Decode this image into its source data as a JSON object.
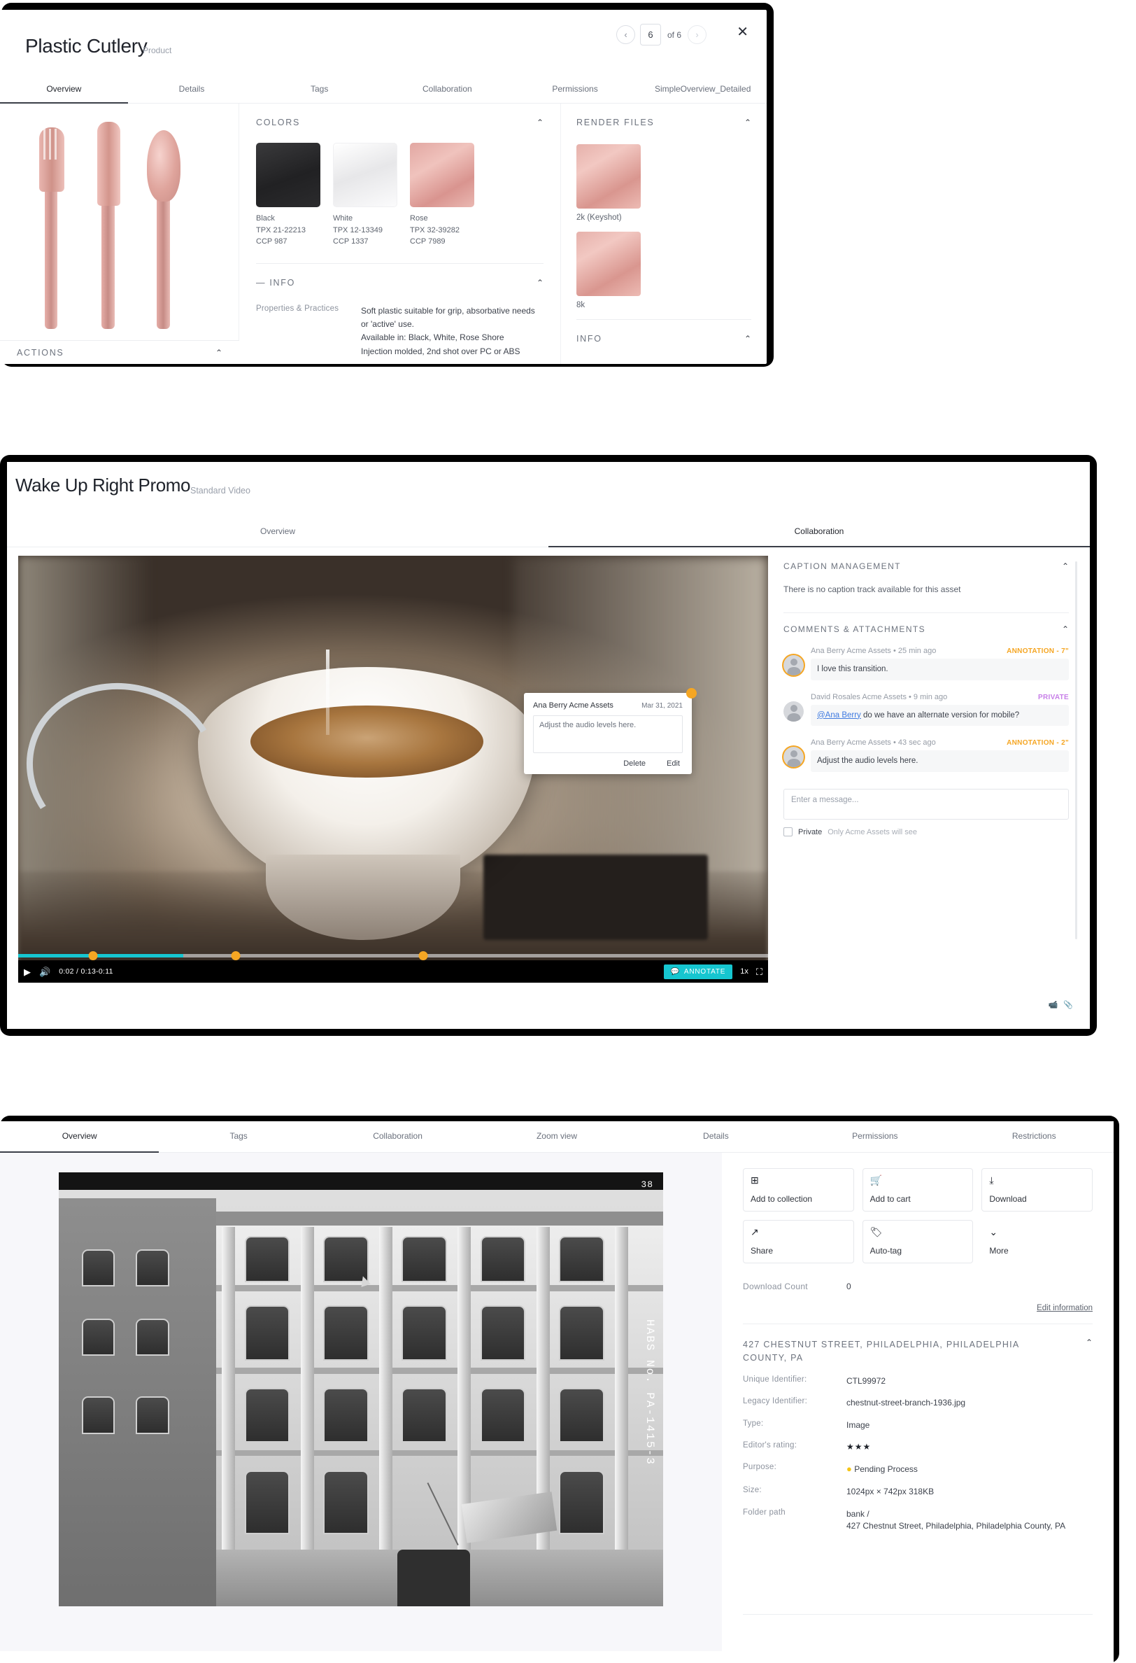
{
  "product_panel": {
    "title": "Plastic Cutlery",
    "subtitle": "Product",
    "pager": {
      "prev": "‹",
      "next": "›",
      "current": "6",
      "of_label": "of 6"
    },
    "close_label": "✕",
    "tabs": [
      {
        "label": "Overview",
        "active": true
      },
      {
        "label": "Details",
        "active": false
      },
      {
        "label": "Tags",
        "active": false
      },
      {
        "label": "Collaboration",
        "active": false
      },
      {
        "label": "Permissions",
        "active": false
      },
      {
        "label": "SimpleOverview_Detailed",
        "active": false
      }
    ],
    "colors_section": {
      "title": "COLORS",
      "swatches": [
        {
          "name": "Black",
          "tpx": "TPX 21-22213",
          "ccp": "CCP 987",
          "hex": "#212123"
        },
        {
          "name": "White",
          "tpx": "TPX 12-13349",
          "ccp": "CCP 1337",
          "hex": "#e7e7e9"
        },
        {
          "name": "Rose",
          "tpx": "TPX 32-39282",
          "ccp": "CCP 7989",
          "hex": "#d9948f"
        }
      ]
    },
    "info_section": {
      "title": "— INFO",
      "label": "Properties & Practices",
      "value": "Soft plastic suitable for grip, absorbative needs or 'active' use.\nAvailable in: Black, White, Rose Shore\nInjection molded, 2nd shot over PC or ABS"
    },
    "render_section": {
      "title": "RENDER FILES",
      "files": [
        {
          "label": "2k (Keyshot)"
        },
        {
          "label": "8k"
        }
      ],
      "info_title": "INFO"
    },
    "actions_label": "ACTIONS"
  },
  "video_panel": {
    "title": "Wake Up Right Promo",
    "subtitle": "Standard Video",
    "tabs": [
      {
        "label": "Overview",
        "active": false
      },
      {
        "label": "Collaboration",
        "active": true
      }
    ],
    "annotation_popup": {
      "author": "Ana Berry Acme Assets",
      "date": "Mar 31, 2021",
      "text": "Adjust the audio levels here.",
      "delete_label": "Delete",
      "edit_label": "Edit"
    },
    "player": {
      "current_time": "0:02",
      "separator": "/",
      "duration": "0:13-0:11",
      "annotate_label": "ANNOTATE",
      "speed_label": "1x",
      "play_icon": "▶",
      "volume_icon": "🔊",
      "fullscreen_icon": "⛶",
      "progress_percent": 22,
      "markers": [
        10,
        29,
        54
      ]
    },
    "caption_section": {
      "title": "CAPTION MANAGEMENT",
      "note": "There is no caption track available for this asset"
    },
    "comments_section": {
      "title": "COMMENTS & ATTACHMENTS",
      "comments": [
        {
          "author": "Ana Berry Acme Assets",
          "time": "• 25 min ago",
          "badge": "ANNOTATION - 7\"",
          "badge_type": "anno",
          "text": "I love this transition."
        },
        {
          "author": "David Rosales Acme Assets",
          "time": "• 9 min ago",
          "badge": "PRIVATE",
          "badge_type": "priv",
          "mention": "@Ana Berry",
          "text": " do we have an alternate version for mobile?"
        },
        {
          "author": "Ana Berry Acme Assets",
          "time": "• 43 sec ago",
          "badge": "ANNOTATION - 2\"",
          "badge_type": "anno",
          "text": "Adjust the audio levels here."
        }
      ],
      "message_placeholder": "Enter a message...",
      "private_label": "Private",
      "private_hint": "Only Acme Assets will see"
    }
  },
  "image_panel": {
    "tabs": [
      {
        "label": "Overview",
        "active": true
      },
      {
        "label": "Tags",
        "active": false
      },
      {
        "label": "Collaboration",
        "active": false
      },
      {
        "label": "Zoom view",
        "active": false
      },
      {
        "label": "Details",
        "active": false
      },
      {
        "label": "Permissions",
        "active": false
      },
      {
        "label": "Restrictions",
        "active": false
      }
    ],
    "photo": {
      "corner_number": "38",
      "habs_caption": "HABS No. PA-1415-3"
    },
    "actions": [
      {
        "label": "Add to collection",
        "icon": "add-collection-icon",
        "glyph": "⊞"
      },
      {
        "label": "Add to cart",
        "icon": "cart-icon",
        "glyph": "🛒"
      },
      {
        "label": "Download",
        "icon": "download-icon",
        "glyph": "⤓"
      },
      {
        "label": "Share",
        "icon": "share-icon",
        "glyph": "↗"
      },
      {
        "label": "Auto-tag",
        "icon": "tag-icon",
        "glyph": "🏷"
      },
      {
        "label": "More",
        "icon": "chevron-down-icon",
        "glyph": "⌄"
      }
    ],
    "download_count_label": "Download Count",
    "download_count_value": "0",
    "edit_information_label": "Edit information",
    "metadata_title": "427 CHESTNUT STREET, PHILADELPHIA, PHILADELPHIA COUNTY, PA",
    "metadata": [
      {
        "label": "Unique Identifier:",
        "value": "CTL99972"
      },
      {
        "label": "Legacy Identifier:",
        "value": "chestnut-street-branch-1936.jpg"
      },
      {
        "label": "Type:",
        "value": "Image"
      },
      {
        "label": "Editor's rating:",
        "value": "★★★"
      },
      {
        "label": "Purpose:",
        "value": "Pending Process"
      },
      {
        "label": "Size:",
        "value": "1024px × 742px     318KB"
      },
      {
        "label": "Folder path",
        "value": "bank /\n427 Chestnut Street, Philadelphia, Philadelphia County, PA"
      }
    ]
  },
  "colors": {
    "accent_teal": "#16c6d0",
    "accent_amber": "#f5a623",
    "accent_purple": "#c77ee8",
    "text_dark": "#23262d",
    "text_muted": "#8d939e"
  }
}
